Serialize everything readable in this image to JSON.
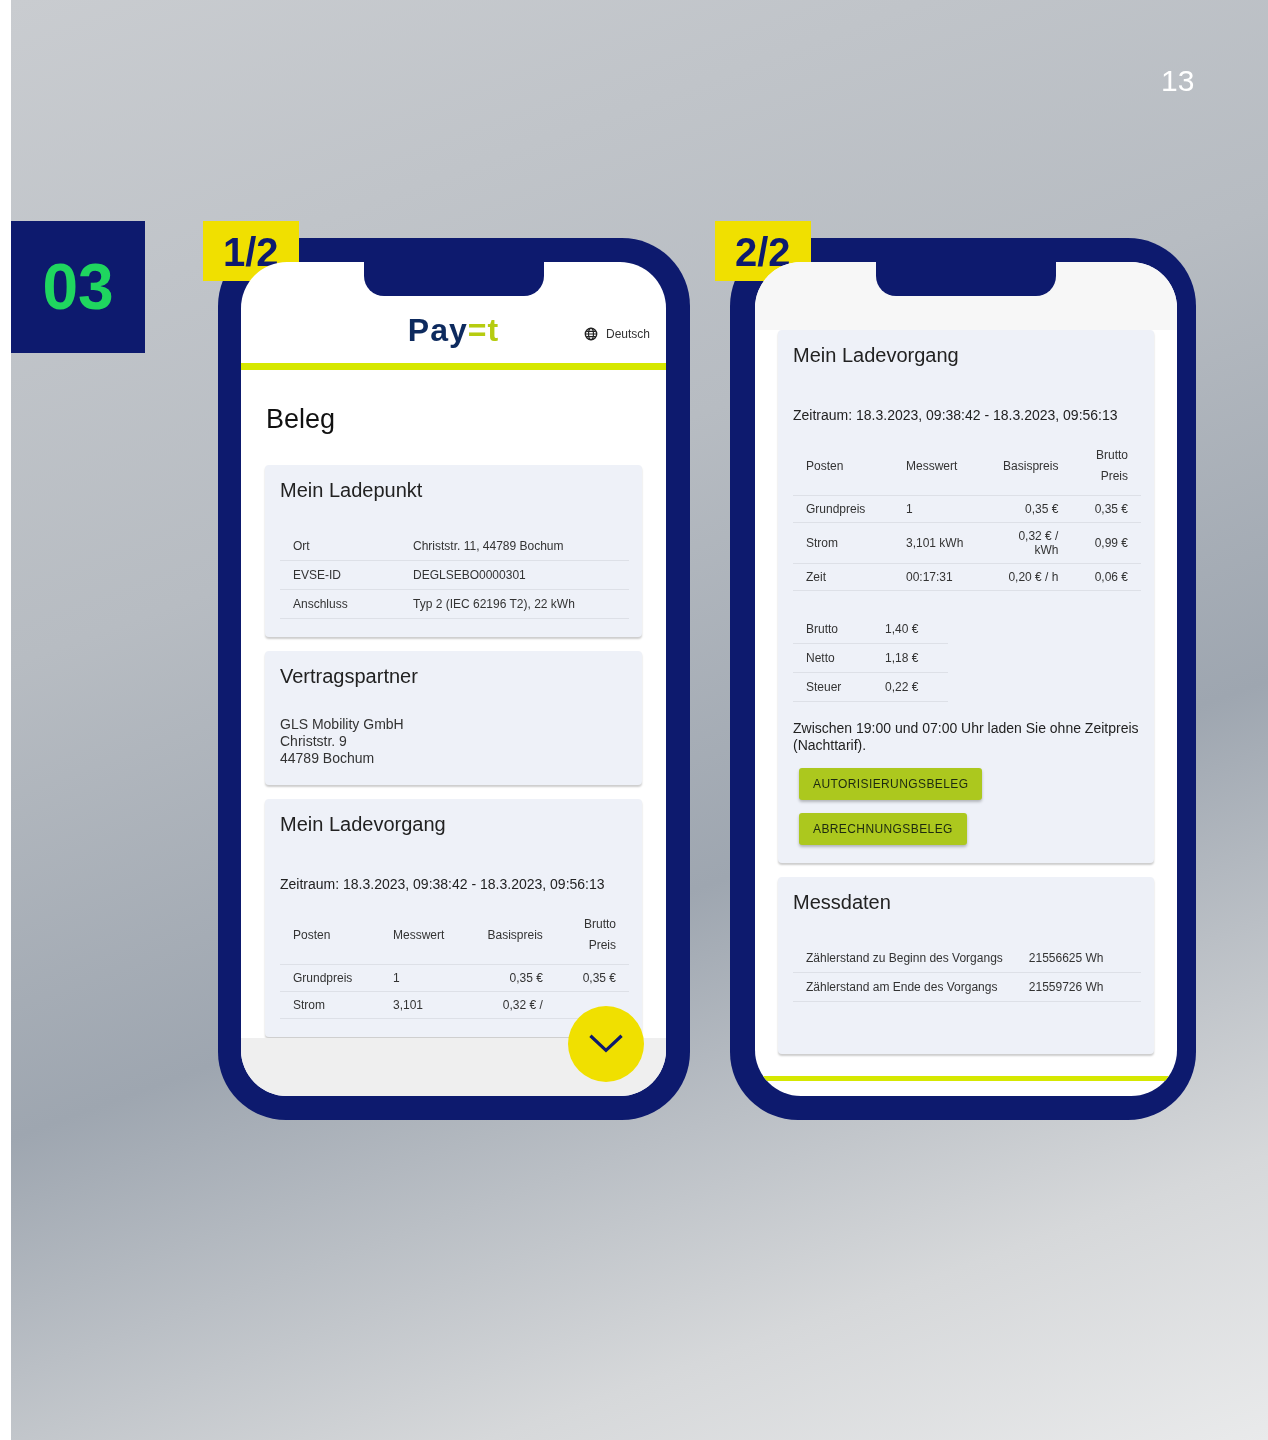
{
  "page_number": "13",
  "section_badge": "03",
  "phones": [
    {
      "step": "1/2",
      "header": {
        "logo_main": "Pay",
        "logo_accent": "=t",
        "language": "Deutsch"
      },
      "page_title": "Beleg",
      "kind": "scrolling",
      "cards": [
        {
          "kind": "pairs",
          "title": "Mein Ladepunkt",
          "rows": [
            [
              "Ort",
              "Christstr. 11, 44789 Bochum"
            ],
            [
              "EVSE-ID",
              "DEGLSEBO0000301"
            ],
            [
              "Anschluss",
              "Typ 2 (IEC 62196 T2), 22 kWh"
            ]
          ]
        },
        {
          "kind": "address",
          "title": "Vertragspartner",
          "lines": [
            "GLS Mobility GmbH",
            "Christstr. 9",
            "44789 Bochum"
          ]
        },
        {
          "kind": "charge",
          "title": "Mein Ladevorgang",
          "period": "Zeitraum: 18.3.2023, 09:38:42 - 18.3.2023, 09:56:13",
          "columns": [
            "Posten",
            "Messwert",
            "Basispreis",
            "Brutto Preis"
          ],
          "items": [
            [
              "Grundpreis",
              "1",
              "0,35 €",
              "0,35 €"
            ],
            [
              "Strom",
              "3,101",
              "0,32 € /"
            ]
          ]
        }
      ]
    },
    {
      "step": "2/2",
      "kind": "end",
      "cards": [
        {
          "kind": "charge",
          "title": "Mein Ladevorgang",
          "period": "Zeitraum: 18.3.2023, 09:38:42 - 18.3.2023, 09:56:13",
          "columns": [
            "Posten",
            "Messwert",
            "Basispreis",
            "Brutto Preis"
          ],
          "items": [
            [
              "Grundpreis",
              "1",
              "0,35 €",
              "0,35 €"
            ],
            [
              "Strom",
              "3,101 kWh",
              "0,32 € / kWh",
              "0,99 €"
            ],
            [
              "Zeit",
              "00:17:31",
              "0,20 € / h",
              "0,06 €"
            ]
          ],
          "totals": [
            [
              "Brutto",
              "1,40 €"
            ],
            [
              "Netto",
              "1,18 €"
            ],
            [
              "Steuer",
              "0,22 €"
            ]
          ],
          "note": "Zwischen 19:00 und 07:00 Uhr laden Sie ohne Zeitpreis (Nachttarif).",
          "buttons": [
            "AUTORISIERUNGSBELEG",
            "ABRECHNUNGSBELEG"
          ]
        },
        {
          "kind": "pairs",
          "title": "Messdaten",
          "rows": [
            [
              "Zählerstand zu Beginn des Vorgangs",
              "21556625 Wh"
            ],
            [
              "Zählerstand am Ende des Vorgangs",
              "21559726 Wh"
            ]
          ]
        }
      ]
    }
  ]
}
